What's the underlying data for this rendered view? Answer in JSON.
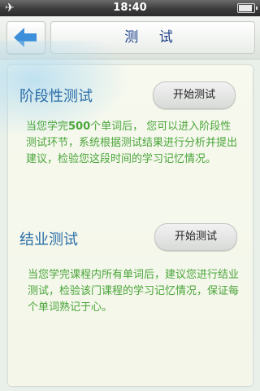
{
  "status_bar": {
    "time": "18:40",
    "airplane_icon": "airplane-icon",
    "battery_icon": "battery-icon"
  },
  "nav": {
    "back_icon": "arrow-left-icon",
    "title": "测 试"
  },
  "sections": [
    {
      "title": "阶段性测试",
      "button_label": "开始测试",
      "desc_pre": "当您学完",
      "desc_num": "500",
      "desc_post": "个单词后， 您可以进入阶段性测试环节，系统根据测试结果进行分析并提出建议，检验您这段时间的学习记忆情况。"
    },
    {
      "title": "结业测试",
      "button_label": "开始测试",
      "desc": "当您学完课程内所有单词后，建议您进行结业测试，检验该门课程的学习记忆情况，保证每个单词熟记于心。"
    }
  ],
  "colors": {
    "title": "#2b6ea8",
    "desc": "#4aa53a",
    "nav_title": "#1d3f8a",
    "back_arrow": "#3d8fd9"
  }
}
